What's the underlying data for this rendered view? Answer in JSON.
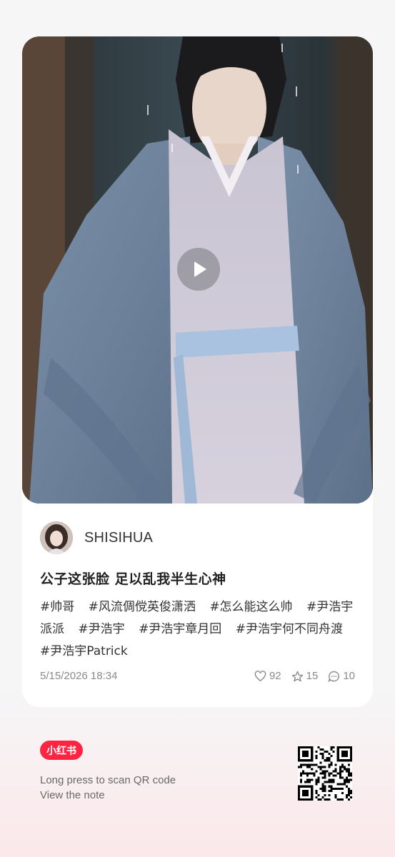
{
  "note": {
    "author": {
      "name": "SHISIHUA"
    },
    "title": "公子这张脸 足以乱我半生心神",
    "tags": [
      "#帅哥",
      "#风流倜傥英俊潇洒",
      "#怎么能这么帅",
      "#尹浩宇派派",
      "#尹浩宇",
      "#尹浩宇章月回",
      "#尹浩宇何不同舟渡",
      "#尹浩宇Patrick"
    ],
    "date": "5/15/2026 18:34",
    "likes": "92",
    "collects": "15",
    "comments": "10"
  },
  "footer": {
    "brand": "小红书",
    "hint_line1": "Long press to scan QR code",
    "hint_line2": "View the note"
  },
  "icons": [
    "play-icon",
    "heart-icon",
    "star-icon",
    "comment-icon",
    "qr-code"
  ],
  "colors": {
    "brand": "#ff2442",
    "background": "#f6f6f7",
    "card": "#ffffff"
  }
}
